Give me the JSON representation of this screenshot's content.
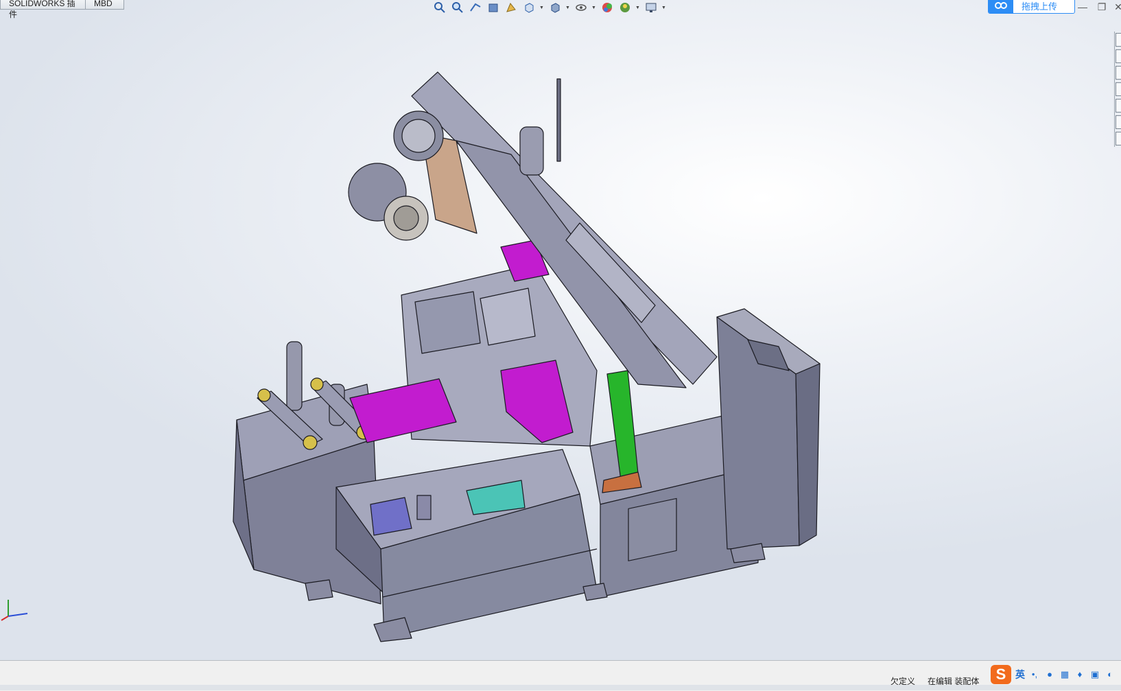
{
  "tabs": {
    "plugins": "SOLIDWORKS 插件",
    "mbd": "MBD"
  },
  "toolbar": {
    "icons": [
      "zoom-to-fit-icon",
      "zoom-to-area-icon",
      "previous-view-icon",
      "section-view-icon",
      "dynamic-annotation-icon",
      "view-orientation-icon",
      "display-style-icon",
      "hide-show-icon",
      "edit-appearance-icon",
      "apply-scene-icon",
      "view-settings-icon"
    ]
  },
  "upload": {
    "label": "拖拽上传"
  },
  "window": {
    "minimize": "—",
    "restore": "❐",
    "close": "✕"
  },
  "status": {
    "definition": "欠定义",
    "editing": "在编辑 装配体"
  },
  "ime": {
    "logo": "S",
    "lang": "英",
    "punct": "•,"
  },
  "colors": {
    "accent": "#2d8df5",
    "body_gray": "#8e90a6",
    "magenta": "#c21ccf",
    "green": "#27b52b",
    "tan": "#c9a58a"
  }
}
